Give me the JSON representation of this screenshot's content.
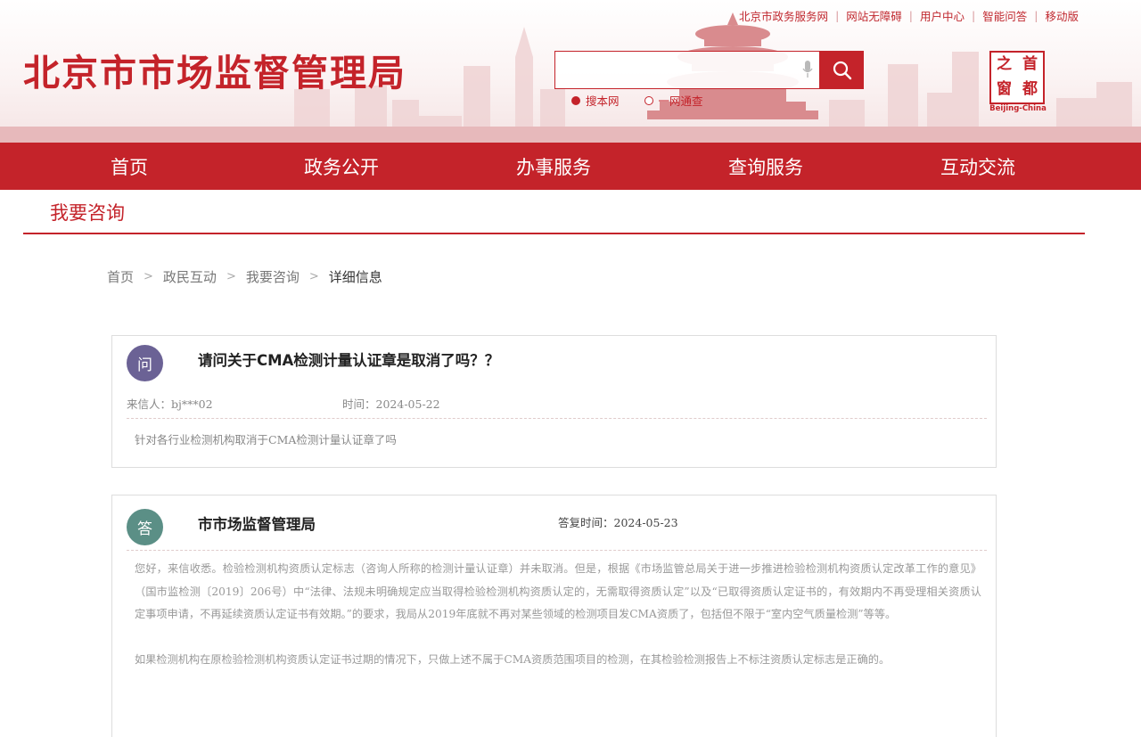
{
  "header": {
    "site_title": "北京市市场监督管理局",
    "top_links": [
      "北京市政务服务网",
      "网站无障碍",
      "用户中心",
      "智能问答",
      "移动版"
    ],
    "search": {
      "placeholder": "",
      "button_icon": "search-icon"
    },
    "search_scopes": [
      {
        "label": "搜本网",
        "selected": true
      },
      {
        "label": "一网通查",
        "selected": false
      }
    ],
    "logo": {
      "chars": [
        "之",
        "首",
        "窗",
        "都"
      ],
      "subtitle": "Beijing-China"
    }
  },
  "nav": {
    "items": [
      "首页",
      "政务公开",
      "办事服务",
      "查询服务",
      "互动交流"
    ]
  },
  "section": {
    "title": "我要咨询"
  },
  "breadcrumb": {
    "items": [
      "首页",
      "政民互动",
      "我要咨询",
      "详细信息"
    ],
    "separator": ">"
  },
  "question": {
    "badge": "问",
    "title": "请问关于CMA检测计量认证章是取消了吗？？",
    "sender_label": "来信人：",
    "sender": "bj***02",
    "time_label": "时间：",
    "time": "2024-05-22",
    "body": "针对各行业检测机构取消于CMA检测计量认证章了吗"
  },
  "answer": {
    "badge": "答",
    "org": "市市场监督管理局",
    "time_label": "答复时间：",
    "time": "2024-05-23",
    "paragraphs": [
      "您好，来信收悉。检验检测机构资质认定标志（咨询人所称的检测计量认证章）并未取消。但是，根据《市场监管总局关于进一步推进检验检测机构资质认定改革工作的意见》（国市监检测〔2019〕206号）中“法律、法规未明确规定应当取得检验检测机构资质认定的，无需取得资质认定”以及“已取得资质认定证书的，有效期内不再受理相关资质认定事项申请，不再延续资质认定证书有效期。”的要求，我局从2019年底就不再对某些领域的检测项目发CMA资质了，包括但不限于“室内空气质量检测”等等。",
      "如果检测机构在原检验检测机构资质认定证书过期的情况下，只做上述不属于CMA资质范围项目的检测，在其检验检测报告上不标注资质认定标志是正确的。"
    ]
  },
  "colors": {
    "brand_red": "#c4232a",
    "question_badge": "#6b6295",
    "answer_badge": "#5b8f86"
  }
}
